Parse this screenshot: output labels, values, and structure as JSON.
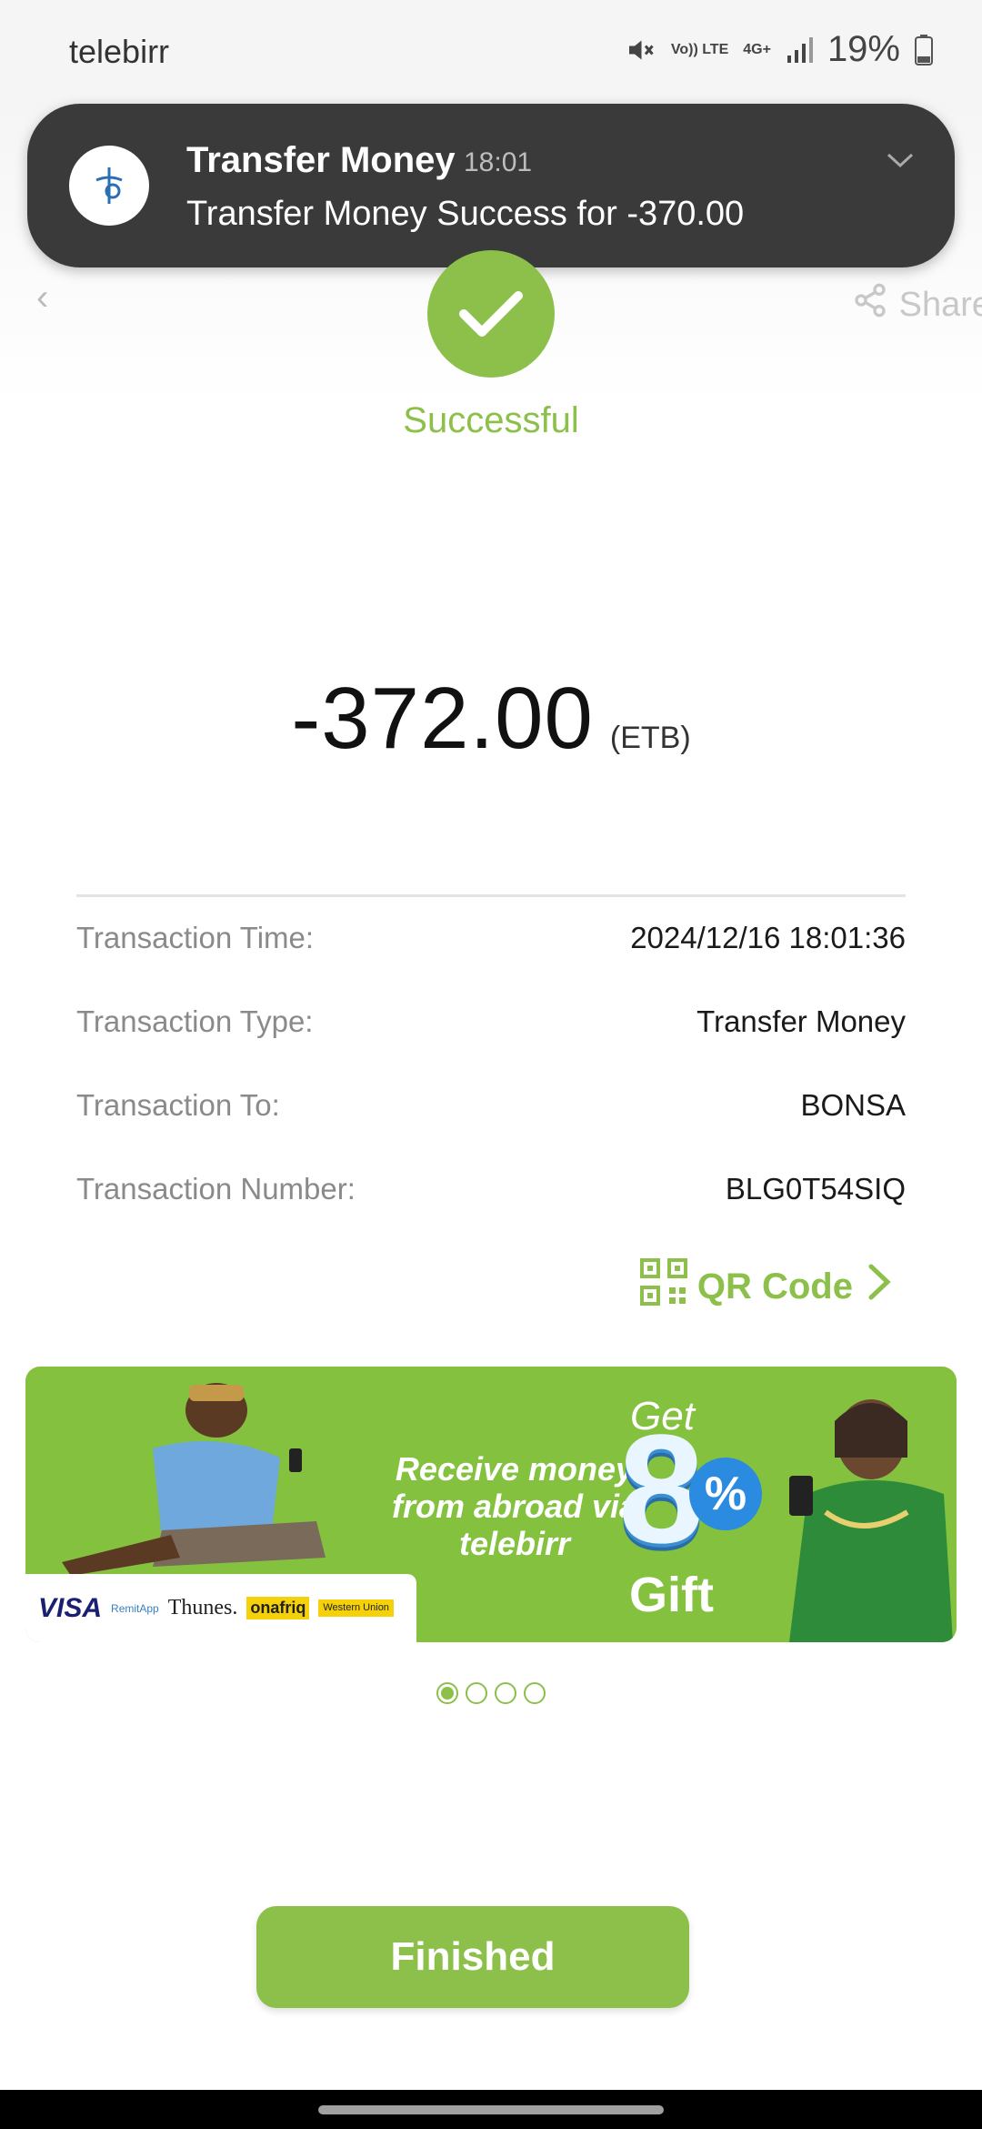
{
  "status_bar": {
    "app_name": "telebirr",
    "network": [
      "Vo)) LTE",
      "4G+"
    ],
    "battery": "19%"
  },
  "header": {
    "share_label": "Share"
  },
  "notification": {
    "title": "Transfer Money",
    "time": "18:01",
    "body": "Transfer Money Success for -370.00"
  },
  "result": {
    "status_text": "Successful",
    "amount": "-372.00",
    "currency": "(ETB)"
  },
  "details": [
    {
      "label": "Transaction Time:",
      "value": "2024/12/16 18:01:36"
    },
    {
      "label": "Transaction Type:",
      "value": "Transfer Money"
    },
    {
      "label": "Transaction To:",
      "value": "BONSA"
    },
    {
      "label": "Transaction Number:",
      "value": "BLG0T54SIQ"
    }
  ],
  "qr_link": {
    "label": "QR Code"
  },
  "banner": {
    "headline": "Receive money from abroad via telebirr",
    "get": "Get",
    "eight": "8",
    "percent": "%",
    "gift": "Gift",
    "partners": [
      "VISA",
      "RemitApp",
      "Thunes.",
      "onafriq",
      "Western Union"
    ],
    "slide_count": 4,
    "active_slide": 1
  },
  "actions": {
    "finish_label": "Finished"
  },
  "colors": {
    "accent": "#8cc04a",
    "notification_bg": "#3a3a3a",
    "banner_bg": "#84c13f"
  }
}
